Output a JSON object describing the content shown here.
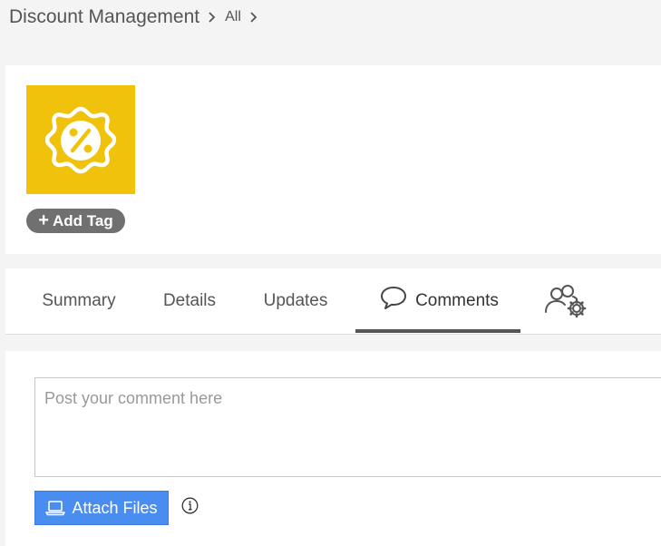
{
  "breadcrumb": {
    "title": "Discount Management",
    "sub": "All"
  },
  "header": {
    "logo_icon": "discount-badge-icon",
    "logo_color": "#f0c20c",
    "add_tag_label": "Add Tag"
  },
  "tabs": [
    {
      "label": "Summary",
      "active": false
    },
    {
      "label": "Details",
      "active": false
    },
    {
      "label": "Updates",
      "active": false
    },
    {
      "label": "Comments",
      "active": true,
      "icon": "speech-bubble-icon"
    },
    {
      "label": "",
      "icon": "users-settings-icon"
    }
  ],
  "comment": {
    "placeholder": "Post your comment here",
    "attach_label": "Attach Files",
    "attach_color": "#4a8df0"
  }
}
